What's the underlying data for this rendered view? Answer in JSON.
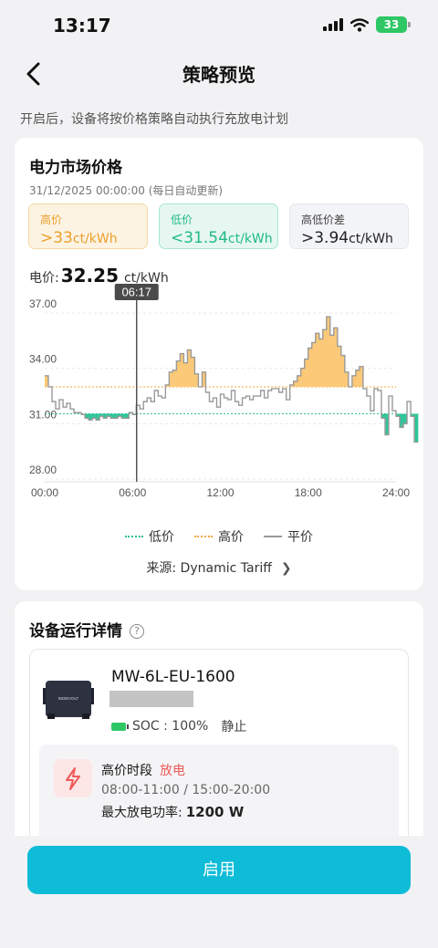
{
  "status_bar": {
    "time": "13:17",
    "battery": "33"
  },
  "header": {
    "title": "策略预览"
  },
  "intro": "开启后，设备将按价格策略自动执行充放电计划",
  "market": {
    "title": "电力市场价格",
    "date": "31/12/2025 00:00:00 (每日自动更新)",
    "high": {
      "label": "高价",
      "value": ">33",
      "unit": "ct/kWh",
      "color": "#eb9f29"
    },
    "low": {
      "label": "低价",
      "value": "<31.54",
      "unit": "ct/kWh",
      "color": "#21b98a"
    },
    "diff": {
      "label": "高低价差",
      "value": ">3.94",
      "unit": "ct/kWh"
    },
    "price": {
      "label": "电价:",
      "value": "32.25",
      "unit": "ct/kWh"
    },
    "legend": {
      "low": "低价",
      "high": "高价",
      "avg": "平价"
    },
    "source": "来源:  Dynamic Tariff"
  },
  "chart_data": {
    "type": "line",
    "cursor_label": "06:17",
    "cursor_x": 6.28,
    "ylim": [
      28,
      37.5
    ],
    "y_ticks": [
      "37.00",
      "34.00",
      "31.00",
      "28.00"
    ],
    "y_tick_values": [
      37,
      34,
      31,
      28
    ],
    "x_ticks": [
      "00:00",
      "06:00",
      "12:00",
      "18:00",
      "24:00"
    ],
    "x_tick_values": [
      0,
      6,
      12,
      18,
      24
    ],
    "high_threshold": 33,
    "low_threshold": 31.54,
    "step_hours": 0.25,
    "values": [
      33.6,
      33.0,
      32.2,
      31.8,
      32.3,
      31.9,
      32.1,
      31.8,
      31.6,
      31.6,
      31.5,
      31.3,
      31.2,
      31.3,
      31.2,
      31.4,
      31.3,
      31.4,
      31.3,
      31.3,
      31.4,
      31.3,
      31.3,
      31.6,
      31.5,
      32.0,
      31.8,
      32.2,
      32.4,
      32.2,
      32.8,
      32.5,
      32.4,
      33.1,
      33.8,
      33.9,
      34.4,
      34.8,
      34.3,
      35.0,
      34.6,
      33.7,
      33.0,
      33.8,
      32.7,
      32.2,
      32.4,
      31.9,
      32.6,
      32.4,
      32.3,
      32.8,
      32.2,
      32.0,
      32.4,
      32.5,
      32.3,
      32.5,
      32.5,
      32.8,
      32.4,
      32.8,
      32.9,
      32.9,
      32.7,
      32.9,
      32.3,
      33.1,
      33.3,
      33.6,
      34.0,
      34.5,
      35.1,
      35.4,
      35.9,
      35.6,
      36.1,
      36.8,
      35.8,
      36.2,
      35.2,
      34.7,
      33.8,
      33.0,
      33.6,
      33.9,
      34.1,
      32.9,
      32.5,
      31.7,
      32.9,
      32.8,
      31.3,
      30.4,
      32.5,
      31.7,
      31.4,
      30.8,
      31.0,
      32.2,
      31.4,
      30.0
    ]
  },
  "device_section": {
    "title": "设备运行详情",
    "help_icon": "?",
    "device": {
      "name": "MW-6L-EU-1600",
      "soc": "SOC : 100%",
      "status": "静止",
      "brand": "INDIEVOLT"
    },
    "period": {
      "title": "高价时段",
      "mode": "放电",
      "times": "08:00-11:00 / 15:00-20:00",
      "power_label": "最大放电功率:",
      "power_value": "1200 W"
    }
  },
  "actions": {
    "enable": "启用"
  }
}
